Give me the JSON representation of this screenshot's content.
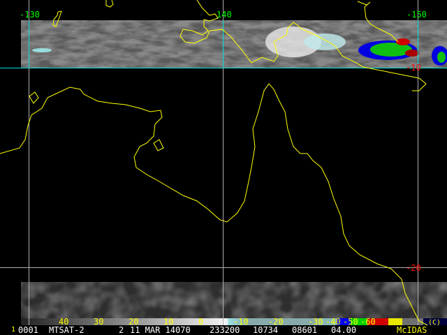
{
  "grid_labels": {
    "lon_130": "-130",
    "lon_140": "140",
    "lon_150": "-150",
    "lat_10": "-10",
    "lat_20": "-20"
  },
  "colorbar": {
    "labels": [
      "40",
      "30",
      "20",
      "10",
      "0",
      "-10",
      "-20",
      "-30",
      "-40",
      "-50",
      "-60"
    ],
    "credit": "(C)"
  },
  "info": {
    "frame": "1",
    "id": "0001",
    "satellite": "MTSAT-2",
    "band": "2",
    "date": "11 MAR 14070",
    "time": "233200",
    "lines": "10734",
    "elems": "08601",
    "res": "04.00",
    "brand": "McIDAS"
  },
  "colors": {
    "grid_strip": "#00e0e0",
    "grid_map": "#b0b0b0",
    "coast": "#ffff00",
    "lon_label": "#00ff00",
    "lat_label": "#ff0000",
    "bar_label": "#ffff00"
  }
}
